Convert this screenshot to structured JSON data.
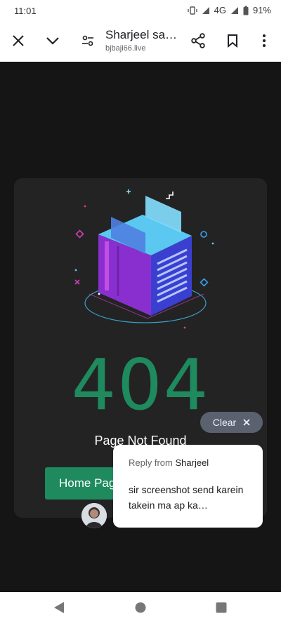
{
  "status": {
    "time": "11:01",
    "network": "4G",
    "battery": "91%"
  },
  "toolbar": {
    "title": "Sharjeel sa…",
    "url": "bjbaji66.live",
    "icons": [
      "close-icon",
      "chevron-down-icon",
      "settings-sliders-icon",
      "share-icon",
      "bookmark-icon",
      "more-vert-icon"
    ]
  },
  "error_page": {
    "code": "404",
    "message": "Page Not Found",
    "home_button": "Home Page"
  },
  "chat_bubble": {
    "clear_label": "Clear",
    "reply_prefix": "Reply from",
    "sender": "Sharjeel",
    "message": "sir screenshot send karein takein ma ap ka…"
  },
  "colors": {
    "accent_green": "#1e8a5e",
    "card_bg": "#232323",
    "page_bg": "#151515"
  }
}
